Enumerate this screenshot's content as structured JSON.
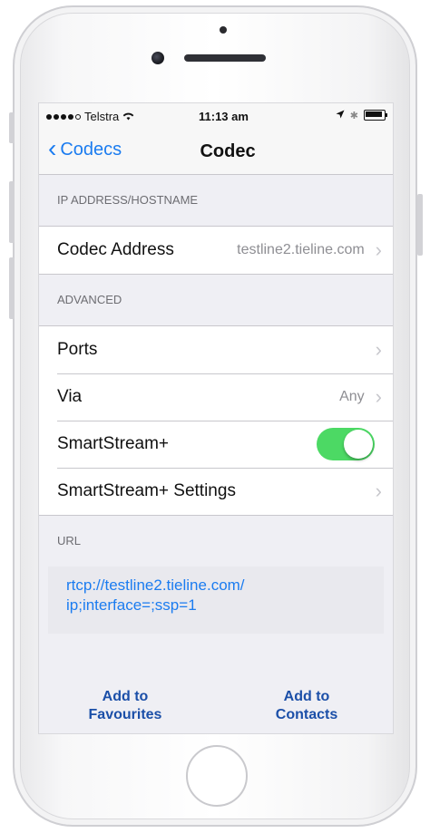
{
  "status_bar": {
    "carrier": "Telstra",
    "time": "11:13 am"
  },
  "nav": {
    "back_label": "Codecs",
    "title": "Codec"
  },
  "sections": {
    "ip": {
      "header": "IP ADDRESS/HOSTNAME",
      "codec_address_label": "Codec Address",
      "codec_address_value": "testline2.tieline.com"
    },
    "advanced": {
      "header": "ADVANCED",
      "ports_label": "Ports",
      "via_label": "Via",
      "via_value": "Any",
      "smartstream_label": "SmartStream+",
      "smartstream_on": true,
      "smartstream_settings_label": "SmartStream+ Settings"
    },
    "url": {
      "header": "URL",
      "line1": "rtcp://testline2.tieline.com/",
      "line2": "ip;interface=;ssp=1"
    }
  },
  "actions": {
    "favourites_line1": "Add to",
    "favourites_line2": "Favourites",
    "contacts_line1": "Add to",
    "contacts_line2": "Contacts"
  },
  "colors": {
    "accent": "#1b7cf0",
    "toggle_on": "#4cd964",
    "action_text": "#1b4fa8"
  }
}
